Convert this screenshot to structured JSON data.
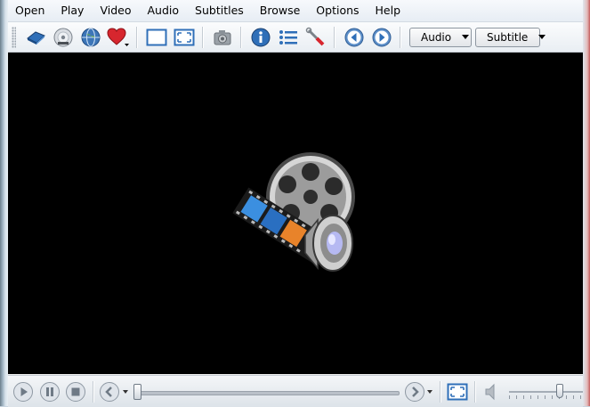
{
  "menu": {
    "items": [
      {
        "label": "Open"
      },
      {
        "label": "Play"
      },
      {
        "label": "Video"
      },
      {
        "label": "Audio"
      },
      {
        "label": "Subtitles"
      },
      {
        "label": "Browse"
      },
      {
        "label": "Options"
      },
      {
        "label": "Help"
      }
    ]
  },
  "toolbar": {
    "buttons": [
      {
        "icon": "open-file-icon"
      },
      {
        "icon": "open-dvd-icon"
      },
      {
        "icon": "open-url-icon"
      },
      {
        "icon": "favorites-icon"
      },
      {
        "icon": "compact-mode-icon"
      },
      {
        "icon": "fullscreen-icon"
      },
      {
        "icon": "screenshot-icon"
      },
      {
        "icon": "info-icon"
      },
      {
        "icon": "playlist-icon"
      },
      {
        "icon": "preferences-icon"
      },
      {
        "icon": "previous-icon"
      },
      {
        "icon": "next-icon"
      }
    ],
    "audio_label": "Audio",
    "subtitle_label": "Subtitle"
  },
  "player": {
    "logo_icon": "smplayer-logo-icon",
    "seek_progress": 0.0,
    "volume_level": 0.7
  },
  "controls": {
    "buttons": [
      {
        "icon": "play-icon"
      },
      {
        "icon": "pause-icon"
      },
      {
        "icon": "stop-icon"
      },
      {
        "icon": "rewind-icon"
      },
      {
        "icon": "forward-icon"
      },
      {
        "icon": "fullscreen-icon"
      },
      {
        "icon": "mute-icon"
      }
    ]
  },
  "colors": {
    "video_background": "#000000",
    "accent_blue": "#2f6fb8",
    "favorite_red": "#d7262e"
  }
}
